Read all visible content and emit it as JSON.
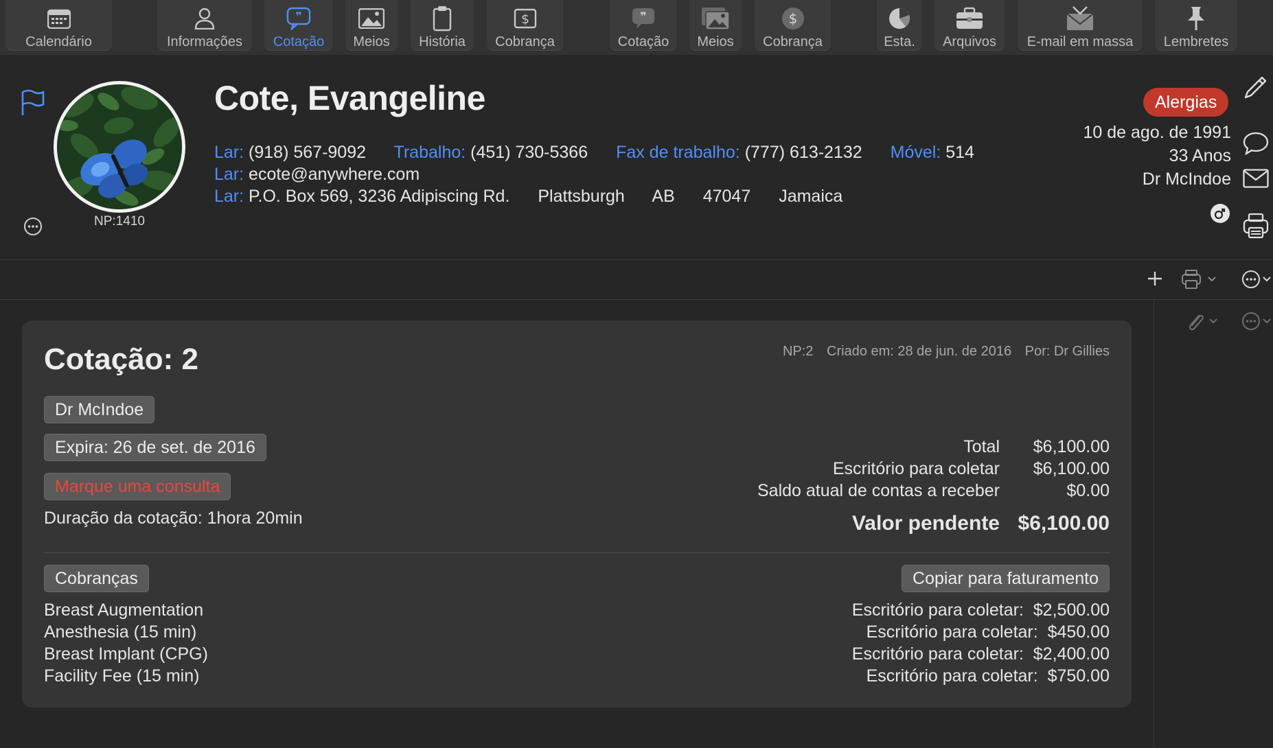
{
  "toolbar": {
    "items": [
      {
        "label": "Calendário",
        "icon": "calendar-icon"
      },
      {
        "label": "Informações",
        "icon": "person-icon"
      },
      {
        "label": "Cotação",
        "icon": "quote-bubble-icon",
        "active": true
      },
      {
        "label": "Meios",
        "icon": "photo-icon"
      },
      {
        "label": "História",
        "icon": "clipboard-icon"
      },
      {
        "label": "Cobrança",
        "icon": "dollar-doc-icon"
      },
      {
        "label": "Cotação",
        "icon": "quote-bubble-icon"
      },
      {
        "label": "Meios",
        "icon": "photos-icon"
      },
      {
        "label": "Cobrança",
        "icon": "dollar-circle-icon"
      },
      {
        "label": "Esta.",
        "icon": "pie-chart-icon"
      },
      {
        "label": "Arquivos",
        "icon": "briefcase-icon"
      },
      {
        "label": "E-mail em massa",
        "icon": "mass-email-icon"
      },
      {
        "label": "Lembretes",
        "icon": "pin-icon"
      }
    ]
  },
  "patient": {
    "name": "Cote, Evangeline",
    "np_id": "NP:1410",
    "phones": [
      {
        "key": "Lar:",
        "value": "(918) 567-9092"
      },
      {
        "key": "Trabalho:",
        "value": "(451) 730-5366"
      },
      {
        "key": "Fax de trabalho:",
        "value": "(777) 613-2132"
      },
      {
        "key": "Móvel:",
        "value": "514"
      }
    ],
    "email": {
      "key": "Lar:",
      "value": "ecote@anywhere.com"
    },
    "address": {
      "key": "Lar:",
      "street": "P.O. Box 569, 3236 Adipiscing Rd.",
      "city": "Plattsburgh",
      "province": "AB",
      "postal": "47047",
      "country": "Jamaica"
    },
    "allergy_badge": "Alergias",
    "dob": "10 de ago. de 1991",
    "age": "33 Anos",
    "doctor": "Dr McIndoe"
  },
  "quote": {
    "title": "Cotação: 2",
    "meta": {
      "np": "NP:2",
      "created": "Criado em: 28 de jun. de 2016",
      "by": "Por: Dr Gillies"
    },
    "doctor_tag": "Dr McIndoe",
    "expires_tag": "Expira: 26 de set. de 2016",
    "appointment_button": "Marque uma consulta",
    "duration": "Duração da cotação: 1hora 20min",
    "totals": [
      {
        "label": "Total",
        "value": "$6,100.00"
      },
      {
        "label": "Escritório para coletar",
        "value": "$6,100.00"
      },
      {
        "label": "Saldo atual de contas a receber",
        "value": "$0.00"
      }
    ],
    "outstanding": {
      "label": "Valor pendente",
      "value": "$6,100.00"
    },
    "charges_tag": "Cobranças",
    "copy_button": "Copiar para faturamento",
    "charges": [
      {
        "name": "Breast Augmentation",
        "label": "Escritório para coletar:",
        "amount": "$2,500.00"
      },
      {
        "name": "Anesthesia (15 min)",
        "label": "Escritório para coletar:",
        "amount": "$450.00"
      },
      {
        "name": "Breast Implant (CPG)",
        "label": "Escritório para coletar:",
        "amount": "$2,400.00"
      },
      {
        "name": "Facility Fee (15 min)",
        "label": "Escritório para coletar:",
        "amount": "$750.00"
      }
    ]
  },
  "colors": {
    "accent": "#4f8ff7",
    "allergy": "#c2382b",
    "warning_text": "#e8473a"
  }
}
